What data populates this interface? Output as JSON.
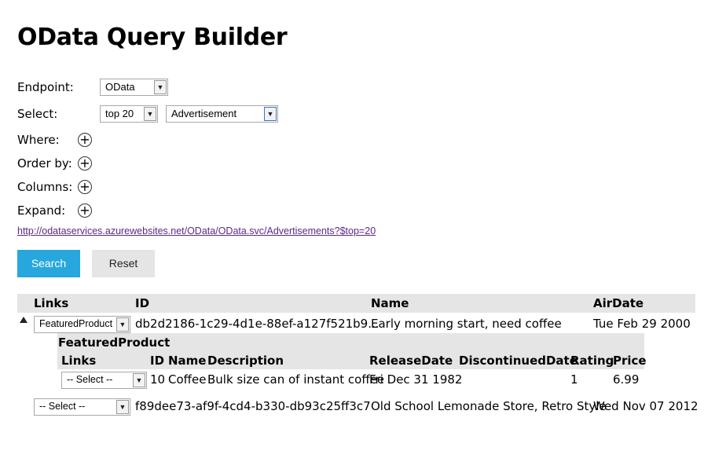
{
  "page": {
    "title": "OData Query Builder"
  },
  "form": {
    "endpoint_label": "Endpoint:",
    "endpoint_value": "OData",
    "select_label": "Select:",
    "top_value": "top 20",
    "entity_value": "Advertisement",
    "where_label": "Where:",
    "orderby_label": "Order by:",
    "columns_label": "Columns:",
    "expand_label": "Expand:",
    "plus_glyph": "+"
  },
  "query_url": "http://odataservices.azurewebsites.net/OData/OData.svc/Advertisements?$top=20",
  "buttons": {
    "search": "Search",
    "reset": "Reset"
  },
  "results": {
    "headers": {
      "links": "Links",
      "id": "ID",
      "name": "Name",
      "airdate": "AirDate"
    },
    "rows": [
      {
        "links_select": "FeaturedProduct",
        "id": "db2d2186-1c29-4d1e-88ef-a127f521b9...",
        "name": "Early morning start, need coffee",
        "airdate": "Tue Feb 29 2000"
      },
      {
        "links_select": "-- Select --",
        "id": "f89dee73-af9f-4cd4-b330-db93c25ff3c7",
        "name": "Old School Lemonade Store, Retro Style",
        "airdate": "Wed Nov 07 2012"
      }
    ],
    "nested": {
      "title": "FeaturedProduct",
      "headers": {
        "links": "Links",
        "id": "ID",
        "name": "Name",
        "description": "Description",
        "releasedate": "ReleaseDate",
        "discontinueddate": "DiscontinuedDate",
        "rating": "Rating",
        "price": "Price"
      },
      "row": {
        "links_select": "-- Select --",
        "id": "10",
        "name": "Coffee",
        "description": "Bulk size can of instant coffee",
        "releasedate": "Fri Dec 31 1982",
        "discontinueddate": "",
        "rating": "1",
        "price": "6.99"
      }
    }
  },
  "icons": {
    "dropdown": "chevron-down-icon",
    "add": "plus-circle-icon",
    "expand": "triangle-up-icon"
  },
  "colors": {
    "search_button": "#27a7de",
    "reset_button": "#e5e5e5",
    "header_band": "#e5e5e5",
    "link": "#5a2a82"
  }
}
